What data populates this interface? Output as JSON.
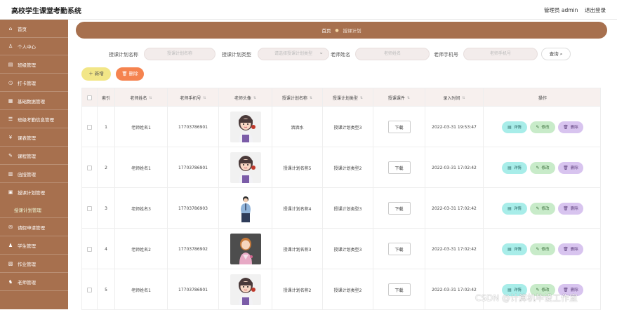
{
  "app": {
    "title": "高校学生课堂考勤系统",
    "admin_label": "管理员 admin",
    "logout_label": "退出登录"
  },
  "sidebar": {
    "items": [
      {
        "icon": "home-icon",
        "glyph": "⌂",
        "label": "首页"
      },
      {
        "icon": "user-icon",
        "glyph": "♙",
        "label": "个人中心"
      },
      {
        "icon": "class-icon",
        "glyph": "▤",
        "label": "班级管理"
      },
      {
        "icon": "clock-icon",
        "glyph": "◷",
        "label": "打卡管理"
      },
      {
        "icon": "data-icon",
        "glyph": "▦",
        "label": "基础数据管理"
      },
      {
        "icon": "attendance-icon",
        "glyph": "☰",
        "label": "班级考勤信息管理"
      },
      {
        "icon": "fee-icon",
        "glyph": "¥",
        "label": "课表管理"
      },
      {
        "icon": "course-icon",
        "glyph": "✎",
        "label": "课程管理"
      },
      {
        "icon": "program-icon",
        "glyph": "▥",
        "label": "函授管理"
      },
      {
        "icon": "plan-icon",
        "glyph": "▣",
        "label": "授课计划管理"
      },
      {
        "icon": "",
        "glyph": "",
        "label": "授课计划管理"
      },
      {
        "icon": "leave-icon",
        "glyph": "✉",
        "label": "请假申请管理"
      },
      {
        "icon": "student-icon",
        "glyph": "♟",
        "label": "学生管理"
      },
      {
        "icon": "homework-icon",
        "glyph": "▧",
        "label": "作业管理"
      },
      {
        "icon": "teacher-icon",
        "glyph": "♞",
        "label": "老师管理"
      }
    ]
  },
  "breadcrumb": {
    "home": "首页",
    "separator": "●",
    "current": "授课计划"
  },
  "search": {
    "fields": [
      {
        "label": "授课计划名称",
        "placeholder": "授课计划名称"
      },
      {
        "label": "授课计划类型",
        "placeholder": "请选择授课计划类型"
      },
      {
        "label": "老师姓名",
        "placeholder": "老师姓名"
      },
      {
        "label": "老师手机号",
        "placeholder": "老师手机号"
      }
    ],
    "query_label": "查询",
    "query_icon": "search-icon"
  },
  "actions": {
    "add_label": "新增",
    "add_icon": "plus-icon",
    "delete_label": "删除",
    "delete_icon": "trash-icon"
  },
  "table": {
    "columns": [
      "索引",
      "老师姓名",
      "老师手机号",
      "老师头像",
      "授课计划名称",
      "授课计划类型",
      "授课课件",
      "录入时间",
      "操作"
    ],
    "download_label": "下载",
    "op_labels": {
      "detail": "详情",
      "edit": "修改",
      "delete": "删除"
    },
    "rows": [
      {
        "index": "1",
        "name": "老师姓名1",
        "phone": "17703786901",
        "avatar": "girl-avatar",
        "plan_name": "洒洒水",
        "plan_type": "授课计划类型3",
        "time": "2022-03-31 19:53:47"
      },
      {
        "index": "2",
        "name": "老师姓名1",
        "phone": "17703786901",
        "avatar": "girl-avatar",
        "plan_name": "授课计划名称5",
        "plan_type": "授课计划类型2",
        "time": "2022-03-31 17:02:42"
      },
      {
        "index": "3",
        "name": "老师姓名3",
        "phone": "17703786903",
        "avatar": "man-avatar",
        "plan_name": "授课计划名称4",
        "plan_type": "授课计划类型3",
        "time": "2022-03-31 17:02:42"
      },
      {
        "index": "4",
        "name": "老师姓名2",
        "phone": "17703786902",
        "avatar": "woman-dark-avatar",
        "plan_name": "授课计划名称3",
        "plan_type": "授课计划类型3",
        "time": "2022-03-31 17:02:42"
      },
      {
        "index": "5",
        "name": "老师姓名1",
        "phone": "17703786901",
        "avatar": "girl-avatar",
        "plan_name": "授课计划名称2",
        "plan_type": "授课计划类型2",
        "time": "2022-03-31 17:02:42"
      }
    ]
  },
  "watermark": "CSDN @计算机毕设工作室",
  "colors": {
    "sidebar": "#a7704e",
    "add_button": "#f2e687",
    "delete_button": "#f5834f"
  }
}
